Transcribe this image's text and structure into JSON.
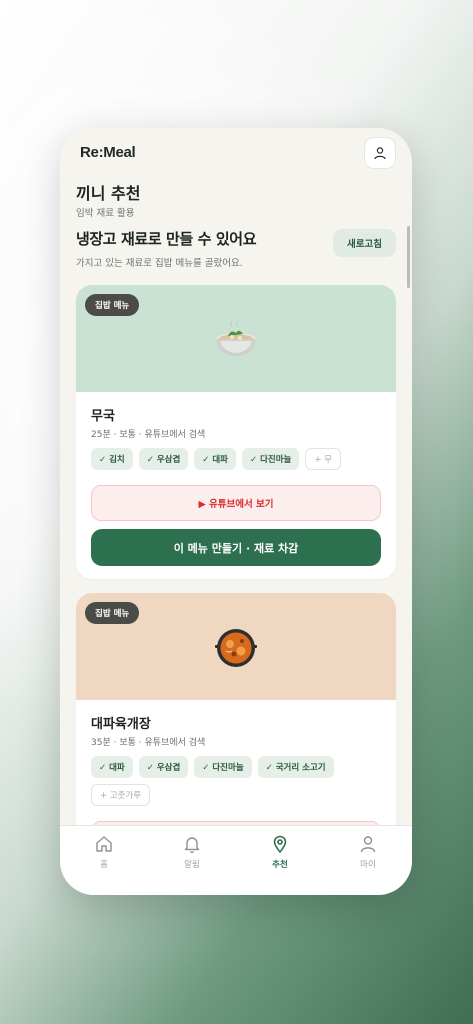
{
  "app": {
    "logo": "Re:Meal"
  },
  "header": {
    "title": "끼니 추천",
    "subtitle": "임박 재료 활용"
  },
  "section": {
    "title": "냉장고 재료로 만들 수 있어요",
    "subtitle": "가지고 있는 재료로 집밥 메뉴를 골랐어요.",
    "refresh_label": "새로고침"
  },
  "recipes": [
    {
      "badge": "집밥 메뉴",
      "name": "무국",
      "meta": "25분 · 보통 · 유튜브에서 검색",
      "icon": "soup-bowl-icon",
      "hero_color": "#c9e2d3",
      "have": [
        "✓ 김치",
        "✓ 우삼겹",
        "✓ 대파",
        "✓ 다진마늘"
      ],
      "missing": [
        "+ 무"
      ],
      "youtube_label": "▶ 유튜브에서 보기",
      "make_label": "이 메뉴 만들기 · 재료 차감"
    },
    {
      "badge": "집밥 메뉴",
      "name": "대파육개장",
      "meta": "35분 · 보통 · 유튜브에서 검색",
      "icon": "hot-pot-icon",
      "hero_color": "#efd7c2",
      "have": [
        "✓ 대파",
        "✓ 우삼겹",
        "✓ 다진마늘",
        "✓ 국거리 소고기"
      ],
      "missing": [
        "+ 고춧가루"
      ]
    }
  ],
  "tabs": [
    {
      "label": "홈",
      "icon": "home-icon",
      "active": false
    },
    {
      "label": "알림",
      "icon": "bell-icon",
      "active": false
    },
    {
      "label": "추천",
      "icon": "location-pin-icon",
      "active": true
    },
    {
      "label": "마이",
      "icon": "user-icon",
      "active": false
    }
  ],
  "colors": {
    "accent": "#2d7050",
    "youtube": "#d92b2b",
    "background": "#f6f4ef"
  }
}
